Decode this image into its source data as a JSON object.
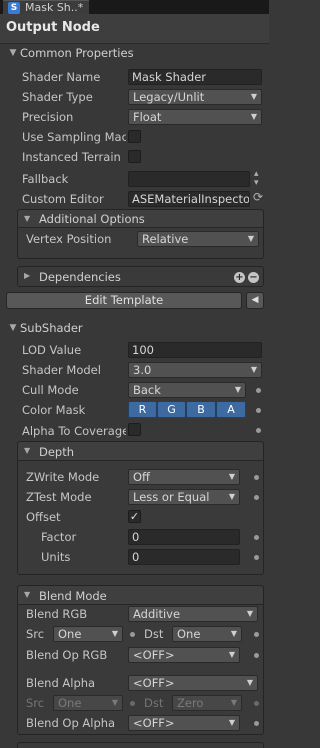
{
  "tab": {
    "icon": "shader-file-icon",
    "icon_glyph": "S",
    "title": "Mask Sh..*"
  },
  "header": {
    "title": "Output Node"
  },
  "common": {
    "title": "Common Properties",
    "shader_name_label": "Shader Name",
    "shader_name_value": "Mask Shader",
    "shader_type_label": "Shader Type",
    "shader_type_value": "Legacy/Unlit",
    "precision_label": "Precision",
    "precision_value": "Float",
    "use_sampling_label": "Use Sampling Mac",
    "instanced_terrain_label": "Instanced Terrain",
    "fallback_label": "Fallback",
    "fallback_value": "",
    "custom_editor_label": "Custom Editor",
    "custom_editor_value": "ASEMaterialInspecto",
    "additional_options_title": "Additional Options",
    "vertex_position_label": "Vertex Position",
    "vertex_position_value": "Relative",
    "dependencies_title": "Dependencies"
  },
  "edit_template_label": "Edit Template",
  "subshader": {
    "title": "SubShader",
    "lod_label": "LOD Value",
    "lod_value": "100",
    "shader_model_label": "Shader Model",
    "shader_model_value": "3.0",
    "cull_mode_label": "Cull Mode",
    "cull_mode_value": "Back",
    "color_mask_label": "Color Mask",
    "color_mask_channels": [
      "R",
      "G",
      "B",
      "A"
    ],
    "alpha_to_coverage_label": "Alpha To Coverage"
  },
  "depth": {
    "title": "Depth",
    "zwrite_label": "ZWrite Mode",
    "zwrite_value": "Off",
    "ztest_label": "ZTest Mode",
    "ztest_value": "Less or Equal",
    "offset_label": "Offset",
    "offset_checked": "✓",
    "factor_label": "Factor",
    "factor_value": "0",
    "units_label": "Units",
    "units_value": "0"
  },
  "blend": {
    "title": "Blend Mode",
    "blend_rgb_label": "Blend RGB",
    "blend_rgb_value": "Additive",
    "src_label": "Src",
    "src_value": "One",
    "dst_label": "Dst",
    "dst_value": "One",
    "blend_op_rgb_label": "Blend Op RGB",
    "blend_op_rgb_value": "<OFF>",
    "blend_alpha_label": "Blend Alpha",
    "blend_alpha_value": "<OFF>",
    "src_alpha_label": "Src",
    "src_alpha_value": "One",
    "dst_alpha_label": "Dst",
    "dst_alpha_value": "Zero",
    "blend_op_alpha_label": "Blend Op Alpha",
    "blend_op_alpha_value": "<OFF>"
  },
  "colors": {
    "accent": "#3d6aa0",
    "background": "#383838"
  }
}
